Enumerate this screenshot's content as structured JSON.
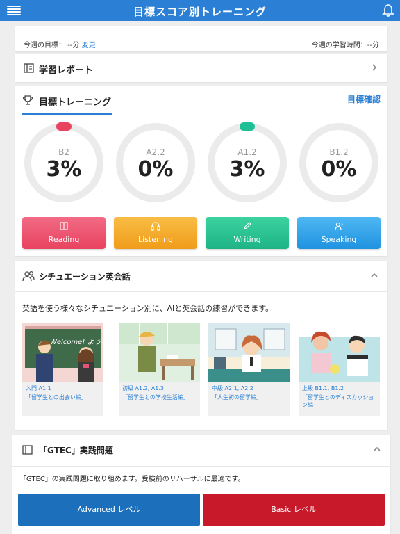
{
  "header": {
    "title": "目標スコア別トレーニング",
    "menu_icon": "hamburger-menu-icon",
    "bell_icon": "bell-icon"
  },
  "goal": {
    "label": "今週の目標：",
    "value": "--分",
    "change": "変更",
    "study_time": "今週の学習時間：--分"
  },
  "report": {
    "title": "学習レポート"
  },
  "training": {
    "title": "目標トレーニング",
    "goal_check": "目標確認",
    "rings": [
      {
        "level": "B2",
        "percent": "3%",
        "progress": 0.03,
        "color": "#e8435f"
      },
      {
        "level": "A2.2",
        "percent": "0%",
        "progress": 0,
        "color": ""
      },
      {
        "level": "A1.2",
        "percent": "3%",
        "progress": 0.03,
        "color": "#1fbf95"
      },
      {
        "level": "B1.2",
        "percent": "0%",
        "progress": 0,
        "color": ""
      }
    ],
    "skills": [
      {
        "label": "Reading",
        "icon": "book-icon"
      },
      {
        "label": "Listening",
        "icon": "headphones-icon"
      },
      {
        "label": "Writing",
        "icon": "pencil-icon"
      },
      {
        "label": "Speaking",
        "icon": "speaking-icon"
      }
    ]
  },
  "situation": {
    "title": "シチュエーション英会話",
    "description": "英語を使う様々なシチュエーション別に、AIと英会話の練習ができます。",
    "cards": [
      {
        "level": "入門 A1.1",
        "title": "「留学生との出会い編」",
        "image_text": "Welcome! ようこそ!"
      },
      {
        "level": "初級 A1.2, A1.3",
        "title": "「留学生との学校生活編」"
      },
      {
        "level": "中級 A2.1, A2.2",
        "title": "「人生初の留学編」"
      },
      {
        "level": "上級 B1.1, B1.2",
        "title": "「留学生とのディスカッション編」"
      }
    ]
  },
  "gtec": {
    "title": "「GTEC」実践問題",
    "description": "「GTEC」の実践問題に取り組めます。受検前のリハーサルに最適です。",
    "advanced": "Advanced レベル",
    "basic": "Basic レベル"
  },
  "colors": {
    "header": "#2b7fd4",
    "reading": "#ef4a6c",
    "listening": "#f3a51f",
    "writing": "#26c08a",
    "speaking": "#2b9de8",
    "advanced": "#1c6fba",
    "basic": "#c8192a"
  }
}
